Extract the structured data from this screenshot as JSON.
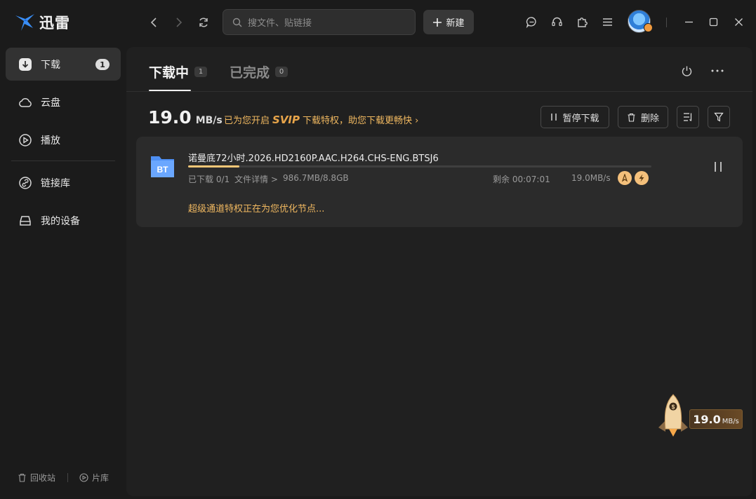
{
  "app": {
    "name": "迅雷"
  },
  "search": {
    "placeholder": "搜文件、贴链接"
  },
  "toolbar": {
    "new_label": "新建"
  },
  "sidebar": {
    "items": [
      {
        "label": "下载",
        "badge": "1",
        "icon": "download-icon"
      },
      {
        "label": "云盘",
        "icon": "cloud-icon"
      },
      {
        "label": "播放",
        "icon": "play-icon"
      },
      {
        "label": "链接库",
        "icon": "link-icon"
      },
      {
        "label": "我的设备",
        "icon": "device-icon"
      }
    ],
    "bottom": {
      "trash": "回收站",
      "library": "片库"
    }
  },
  "tabs": [
    {
      "label": "下载中",
      "count": "1",
      "active": true
    },
    {
      "label": "已完成",
      "count": "0",
      "active": false
    }
  ],
  "speed": {
    "value": "19.0",
    "unit": "MB/s"
  },
  "promo": {
    "pre": "已为您开启",
    "svip": "SVIP",
    "post": "下载特权，助您下载更畅快 ›"
  },
  "actions": {
    "pause_label": "暂停下载",
    "delete_label": "删除"
  },
  "task": {
    "name": "诺曼底72小时.2026.HD2160P.AAC.H264.CHS-ENG.BTSJ6",
    "file_type": "BT",
    "progress": 0.11,
    "downloaded_files": "已下载 0/1",
    "details_link": "文件详情 >",
    "size": "986.7MB/8.8GB",
    "remaining": "剩余 00:07:01",
    "speed": "19.0MB/s",
    "status_msg": "超级通道特权正在为您优化节点..."
  },
  "float_widget": {
    "value": "19.0",
    "unit": "MB/s"
  },
  "colors": {
    "accent": "#f0b860",
    "progress": "#f5c777",
    "bg": "#1b1b1b"
  }
}
